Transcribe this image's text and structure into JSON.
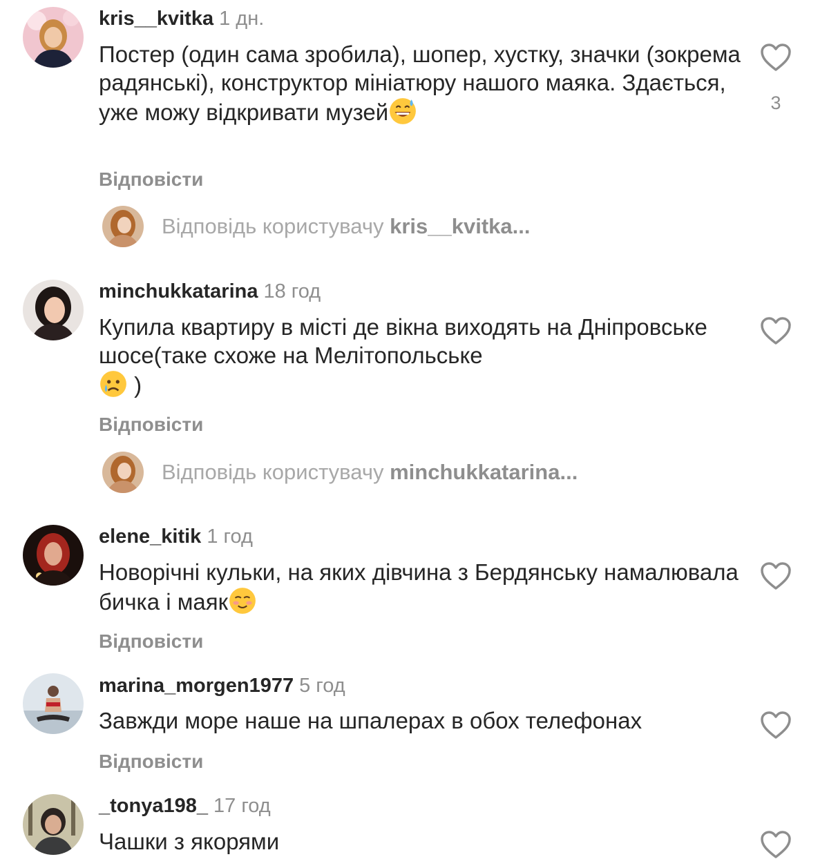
{
  "comments": [
    {
      "username": "kris__kvitka",
      "time": "1 дн.",
      "text": "Постер (один сама зробила), шопер, хустку, значки (зокрема радянські), конструктор мініатюру нашого маяка. Здається, уже можу відкривати музей",
      "emoji": "grinning-sweat-emoji",
      "likes": "3",
      "reply_label": "Відповісти",
      "reply_prompt": "Відповідь користувачу",
      "reply_target": "kris__kvitka..."
    },
    {
      "username": "minchukkatarina",
      "time": "18 год",
      "text": "Купила квартиру в місті де вікна виходять на Дніпровське шосе(таке схоже на Мелітопольське",
      "text_after_emoji": ")",
      "emoji": "crying-face-emoji",
      "reply_label": "Відповісти",
      "reply_prompt": "Відповідь користувачу",
      "reply_target": "minchukkatarina..."
    },
    {
      "username": "elene_kitik",
      "time": "1 год",
      "text": "Новорічні кульки, на яких дівчина з Бердянську намалювала бичка і маяк",
      "emoji": "smiling-face-emoji",
      "reply_label": "Відповісти"
    },
    {
      "username": "marina_morgen1977",
      "time": "5 год",
      "text": "Завжди море наше на шпалерах в обох телефонах",
      "reply_label": "Відповісти"
    },
    {
      "username": "_tonya198_",
      "time": "17 год",
      "text": "Чашки з якорями"
    }
  ],
  "colors": {
    "text": "#262626",
    "secondary": "#8e8e8e",
    "placeholder": "#a8a8a8"
  }
}
